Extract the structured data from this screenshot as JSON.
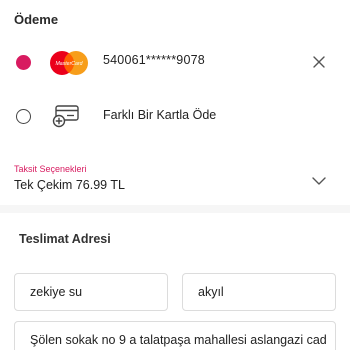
{
  "payment": {
    "title": "Ödeme",
    "saved_card": {
      "number": "540061******9078",
      "brand_icon": "mastercard-icon",
      "brand_text": "MasterCard",
      "selected": true,
      "remove_icon": "close-icon"
    },
    "new_card": {
      "label": "Farklı Bir Kartla Öde",
      "icon": "credit-card-add-icon",
      "selected": false
    },
    "installment": {
      "label": "Taksit Seçenekleri",
      "value": "Tek Çekim 76.99 TL",
      "icon": "chevron-down-icon"
    }
  },
  "delivery": {
    "title": "Teslimat Adresi",
    "first_name": "zekiye su",
    "last_name": "akyıl",
    "address": "Şölen sokak no 9 a talatpaşa mahallesi aslangazi cad"
  },
  "colors": {
    "accent": "#d81b60",
    "mastercard_red": "#eb001b",
    "mastercard_orange": "#f79e1b"
  }
}
